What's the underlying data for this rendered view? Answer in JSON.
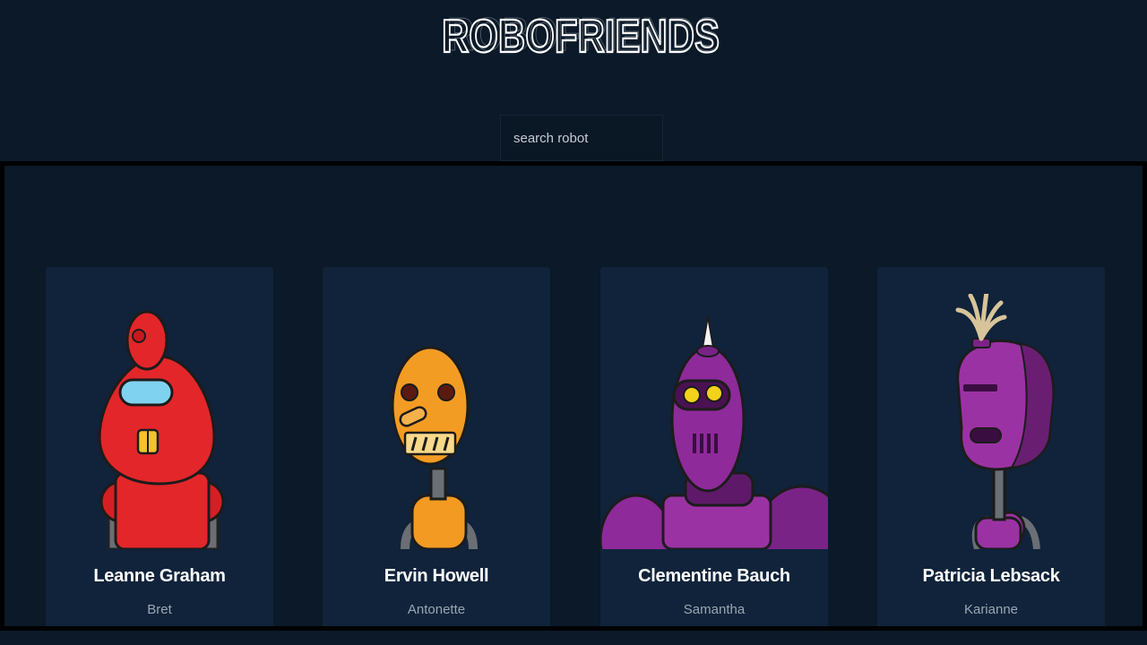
{
  "header": {
    "title": "ROBOFRIENDS"
  },
  "search": {
    "placeholder": "search robot",
    "value": ""
  },
  "robots": [
    {
      "name": "Leanne Graham",
      "username": "Bret",
      "color": "#e3262a"
    },
    {
      "name": "Ervin Howell",
      "username": "Antonette",
      "color": "#f29a22"
    },
    {
      "name": "Clementine Bauch",
      "username": "Samantha",
      "color": "#8e2a9a"
    },
    {
      "name": "Patricia Lebsack",
      "username": "Karianne",
      "color": "#9b32a3"
    }
  ],
  "colors": {
    "background": "#0b1928",
    "card": "#10233a",
    "name": "#ffffff",
    "username": "#9aa6b3"
  }
}
